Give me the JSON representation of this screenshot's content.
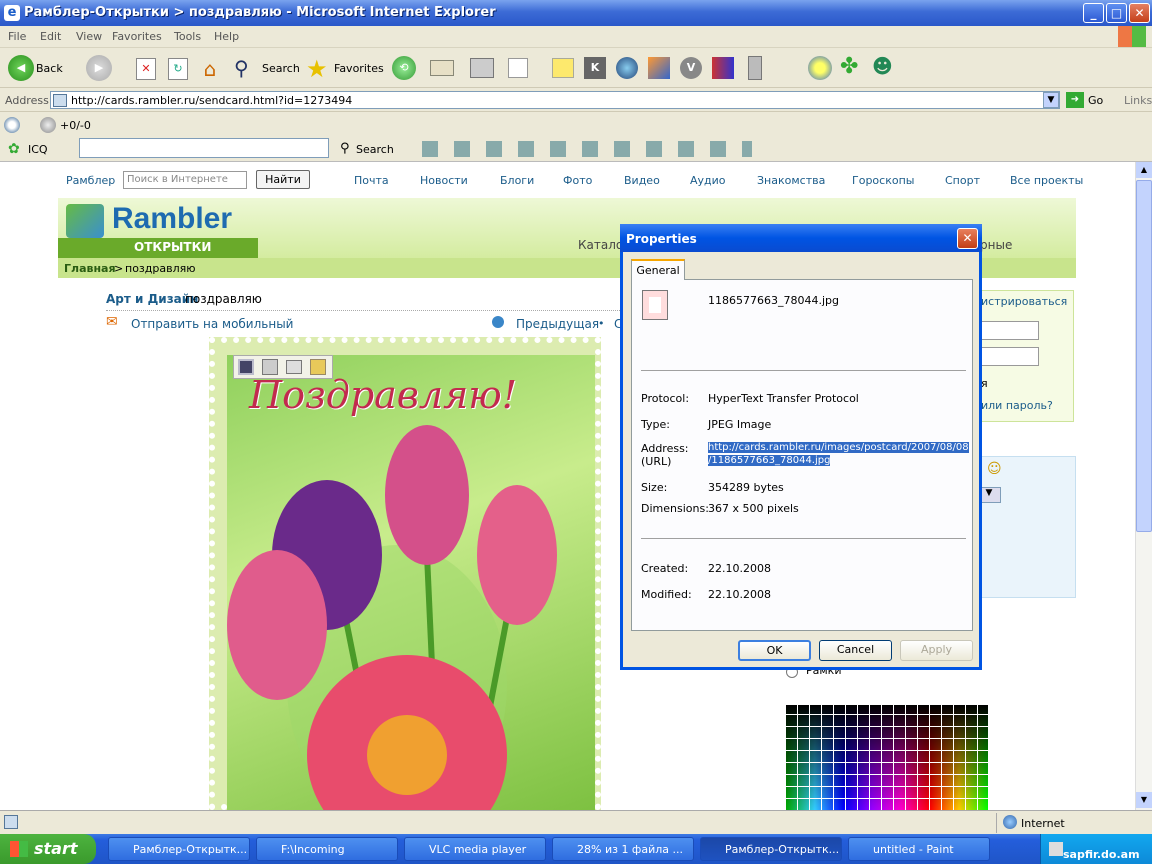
{
  "window": {
    "title": "Рамблер-Открытки > поздравляю - Microsoft Internet Explorer",
    "minimize": "_",
    "maximize": "□",
    "close": "✕"
  },
  "menu": [
    "File",
    "Edit",
    "View",
    "Favorites",
    "Tools",
    "Help"
  ],
  "toolbar": {
    "back": "Back",
    "search": "Search",
    "favorites": "Favorites"
  },
  "address": {
    "label": "Address",
    "url": "http://cards.rambler.ru/sendcard.html?id=1273494",
    "go": "Go",
    "links": "Links"
  },
  "toolbar3": {
    "counter": "+0/-0"
  },
  "toolbar4": {
    "icq": "ICQ",
    "search": "Search"
  },
  "site": {
    "topnav": [
      "Рамблер",
      "Почта",
      "Новости",
      "Блоги",
      "Фото",
      "Видео",
      "Аудио",
      "Знакомства",
      "Гороскопы",
      "Спорт",
      "Все проекты"
    ],
    "search_placeholder": "Поиск в Интернете",
    "search_button": "Найти",
    "logo": "Rambler",
    "logo_sub": "ОТКРЫТКИ",
    "tabs": [
      "Катало",
      "рные"
    ],
    "breadcrumb_home": "Главная",
    "breadcrumb_sep": ">",
    "breadcrumb_current": "поздравляю",
    "category_link": "Арт и Дизайн",
    "category_title": "поздравляю",
    "send_mobile": "Отправить на мобильный",
    "prev": "Предыдущая",
    "next_fragment": "С",
    "register": "истрироваться",
    "forgot": "или пароль?",
    "frag_ya": "я",
    "frame_label": "Рамки",
    "card_text": "Поздравляю!"
  },
  "dialog": {
    "title": "Properties",
    "tab": "General",
    "filename": "1186577663_78044.jpg",
    "protocol_label": "Protocol:",
    "protocol": "HyperText Transfer Protocol",
    "type_label": "Type:",
    "type": "JPEG Image",
    "address_label": "Address:",
    "url_label": "(URL)",
    "address_line1": "http://cards.rambler.ru/images/postcard/2007/08/08",
    "address_line2": "/1186577663_78044.jpg",
    "size_label": "Size:",
    "size": "354289 bytes",
    "dims_label": "Dimensions:",
    "dims": "367  x  500  pixels",
    "created_label": "Created:",
    "created": "22.10.2008",
    "modified_label": "Modified:",
    "modified": "22.10.2008",
    "ok": "OK",
    "cancel": "Cancel",
    "apply": "Apply"
  },
  "status": {
    "zone": "Internet"
  },
  "taskbar": {
    "start": "start",
    "tasks": [
      "Рамблер-Открытк...",
      "F:\\Incoming",
      "VLC media player",
      "28% из 1 файла ...",
      "Рамблер-Открытк...",
      "untitled - Paint"
    ],
    "watermark": "sapfir.do.am"
  }
}
